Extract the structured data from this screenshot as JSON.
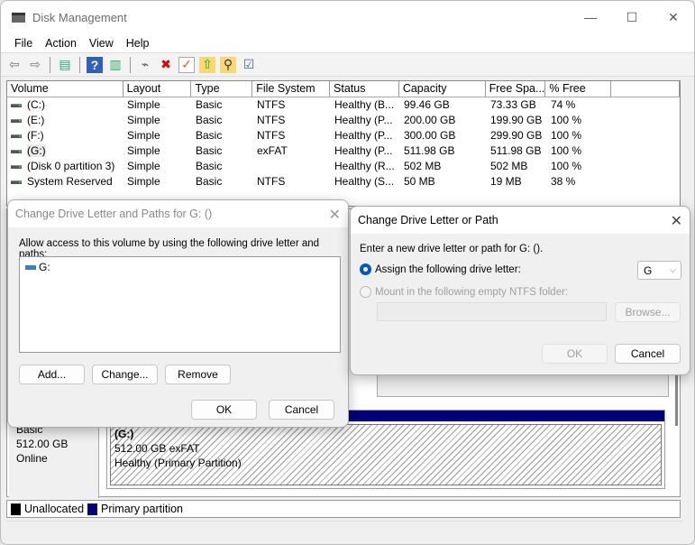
{
  "window": {
    "title": "Disk Management",
    "minimize": "—",
    "maximize": "☐",
    "close": "✕"
  },
  "menu": [
    "File",
    "Action",
    "View",
    "Help"
  ],
  "toolbar": {
    "icons": [
      "back-arrow-icon",
      "forward-arrow-icon",
      "console-tree-icon",
      "help-icon",
      "action-pane-icon",
      "connect-drive-icon",
      "delete-icon",
      "properties-icon",
      "open-folder-up-icon",
      "explore-icon",
      "checklist-icon"
    ],
    "glyphs": [
      "⇦",
      "⇨",
      "▤",
      "?",
      "▥",
      "⌁",
      "✖",
      "✓",
      "⇧",
      "⚲",
      "☑"
    ]
  },
  "volumes": {
    "columns": [
      "Volume",
      "Layout",
      "Type",
      "File System",
      "Status",
      "Capacity",
      "Free Spa...",
      "% Free",
      ""
    ],
    "rows": [
      [
        "(C:)",
        "Simple",
        "Basic",
        "NTFS",
        "Healthy (B...",
        "99.46 GB",
        "73.33 GB",
        "74 %"
      ],
      [
        "(E:)",
        "Simple",
        "Basic",
        "NTFS",
        "Healthy (P...",
        "200.00 GB",
        "199.90 GB",
        "100 %"
      ],
      [
        "(F:)",
        "Simple",
        "Basic",
        "NTFS",
        "Healthy (P...",
        "300.00 GB",
        "299.90 GB",
        "100 %"
      ],
      [
        "(G:)",
        "Simple",
        "Basic",
        "exFAT",
        "Healthy (P...",
        "511.98 GB",
        "511.98 GB",
        "100 %"
      ],
      [
        "(Disk 0 partition 3)",
        "Simple",
        "Basic",
        "",
        "Healthy (R...",
        "502 MB",
        "502 MB",
        "100 %"
      ],
      [
        "System Reserved",
        "Simple",
        "Basic",
        "NTFS",
        "Healthy (S...",
        "50 MB",
        "19 MB",
        "38 %"
      ]
    ]
  },
  "disk": {
    "type": "Basic",
    "size": "512.00 GB",
    "state": "Online",
    "partition": {
      "name": "(G:)",
      "size_fs": "512.00 GB exFAT",
      "status": "Healthy (Primary Partition)"
    }
  },
  "legend": [
    {
      "label": "Unallocated",
      "color": "#000000"
    },
    {
      "label": "Primary partition",
      "color": "#00007b"
    }
  ],
  "dialog_paths": {
    "title": "Change Drive Letter and Paths for G: ()",
    "instruction": "Allow access to this volume by using the following drive letter and paths:",
    "entries": [
      "G:"
    ],
    "add": "Add...",
    "change": "Change...",
    "remove": "Remove",
    "ok": "OK",
    "cancel": "Cancel"
  },
  "dialog_change": {
    "title": "Change Drive Letter or Path",
    "prompt": "Enter a new drive letter or path for G: ().",
    "assign_label": "Assign the following drive letter:",
    "assign_selected": true,
    "drive_letter": "G",
    "mount_label": "Mount in the following empty NTFS folder:",
    "folder_value": "",
    "browse": "Browse...",
    "ok": "OK",
    "cancel": "Cancel"
  }
}
